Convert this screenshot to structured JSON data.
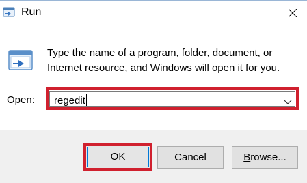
{
  "window": {
    "title": "Run",
    "description": "Type the name of a program, folder, document, or Internet resource, and Windows will open it for you."
  },
  "open": {
    "label_accel": "O",
    "label_rest": "pen:",
    "value": "regedit"
  },
  "buttons": {
    "ok": "OK",
    "cancel": "Cancel",
    "browse_accel": "B",
    "browse_rest": "rowse..."
  },
  "icons": {
    "title": "run-app-icon",
    "close": "close-icon",
    "run": "run-program-icon",
    "dropdown": "chevron-down-icon"
  },
  "colors": {
    "highlight": "#d0202e",
    "focus": "#0078d7",
    "footer": "#f0f0f0"
  }
}
